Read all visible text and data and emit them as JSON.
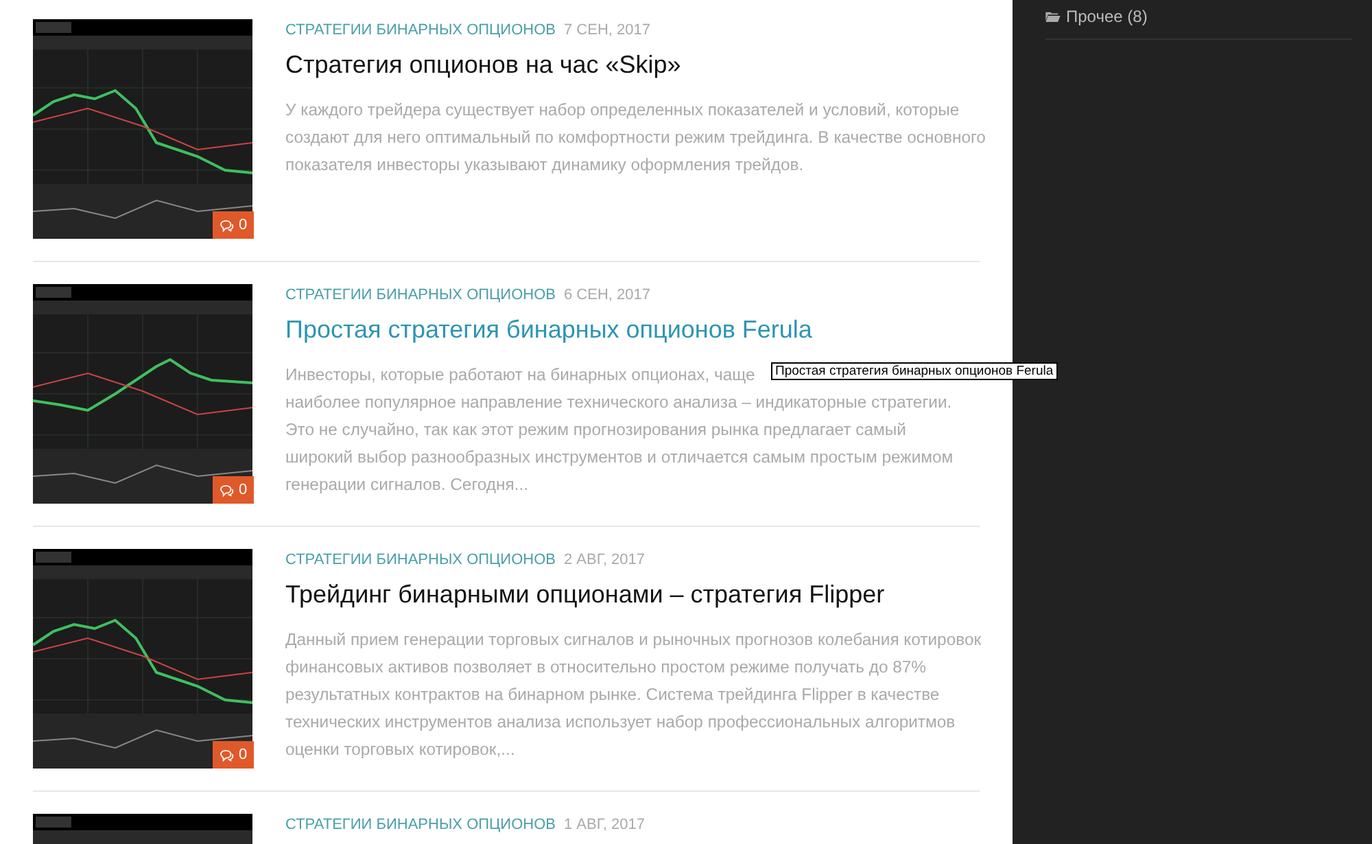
{
  "posts": [
    {
      "category": "СТРАТЕГИИ БИНАРНЫХ ОПЦИОНОВ",
      "date": "7 СЕН, 2017",
      "title": "Стратегия опционов на час «Skip»",
      "hovered": false,
      "excerpt": "У каждого трейдера существует набор определенных показателей и условий, которые создают для него оптимальный по комфортности режим трейдинга. В качестве основного показателя инвесторы указывают динамику оформления трейдов.",
      "comments": "0"
    },
    {
      "category": "СТРАТЕГИИ БИНАРНЫХ ОПЦИОНОВ",
      "date": "6 СЕН, 2017",
      "title": "Простая стратегия бинарных опционов Ferula",
      "hovered": true,
      "excerpt_lines": [
        "Инвесторы, которые работают на бинарных опционах, чаще",
        "наиболее популярное направление технического анализа – индикаторные стратегии.",
        "Это не случайно, так как этот режим прогнозирования рынка предлагает самый",
        "широкий выбор разнообразных инструментов и отличается самым простым режимом",
        "генерации сигналов. Сегодня..."
      ],
      "comments": "0"
    },
    {
      "category": "СТРАТЕГИИ БИНАРНЫХ ОПЦИОНОВ",
      "date": "2 АВГ, 2017",
      "title": "Трейдинг бинарными опционами – стратегия Flipper",
      "hovered": false,
      "excerpt": "Данный прием генерации торговых сигналов и рыночных прогнозов колебания котировок финансовых активов позволяет в относительно простом режиме получать до 87% результатных контрактов на бинарном рынке. Система трейдинга Flipper в качестве технических инструментов анализа использует набор профессиональных алгоритмов оценки торговых котировок,...",
      "comments": "0"
    },
    {
      "category": "СТРАТЕГИИ БИНАРНЫХ ОПЦИОНОВ",
      "date": "1 АВГ, 2017"
    }
  ],
  "tooltip": "Простая стратегия бинарных опционов Ferula",
  "sidebar": {
    "categories": [
      {
        "label": "Прочее (8)"
      }
    ]
  }
}
